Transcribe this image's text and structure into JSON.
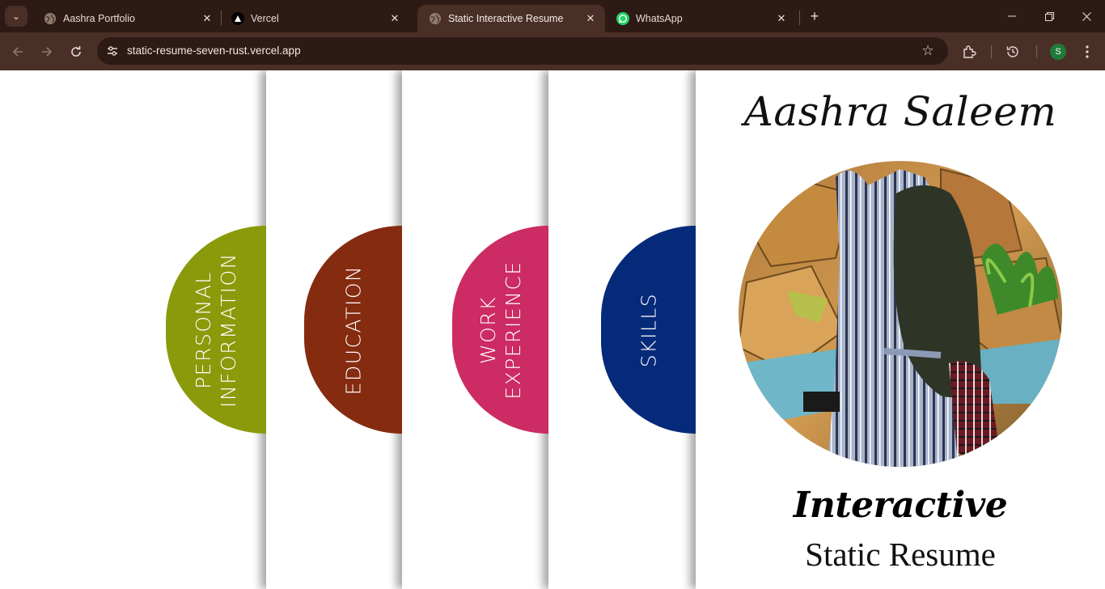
{
  "browser": {
    "tabs": [
      {
        "title": "Aashra Portfolio",
        "favicon": "globe-icon",
        "active": false
      },
      {
        "title": "Vercel",
        "favicon": "vercel-triangle-icon",
        "active": false
      },
      {
        "title": "Static Interactive Resume",
        "favicon": "globe-icon",
        "active": true
      },
      {
        "title": "WhatsApp",
        "favicon": "whatsapp-icon",
        "active": false
      }
    ],
    "url": "static-resume-seven-rust.vercel.app",
    "profile_initial": "S",
    "colors": {
      "frame": "#2e1a14",
      "toolbar": "#4a2f26",
      "profile": "#1f7a3a",
      "whatsapp": "#25d366"
    }
  },
  "resume": {
    "name": "Aashra Saleem",
    "sections": [
      {
        "label": "Personal\nInformation",
        "color": "#8a9a0b"
      },
      {
        "label": "Education",
        "color": "#852b10"
      },
      {
        "label": "Work\nExperience",
        "color": "#cc2b64"
      },
      {
        "label": "Skills",
        "color": "#062a7a"
      }
    ],
    "tagline_line1": "Interactive",
    "tagline_line2": "Static Resume",
    "photo": "profile-photo"
  }
}
